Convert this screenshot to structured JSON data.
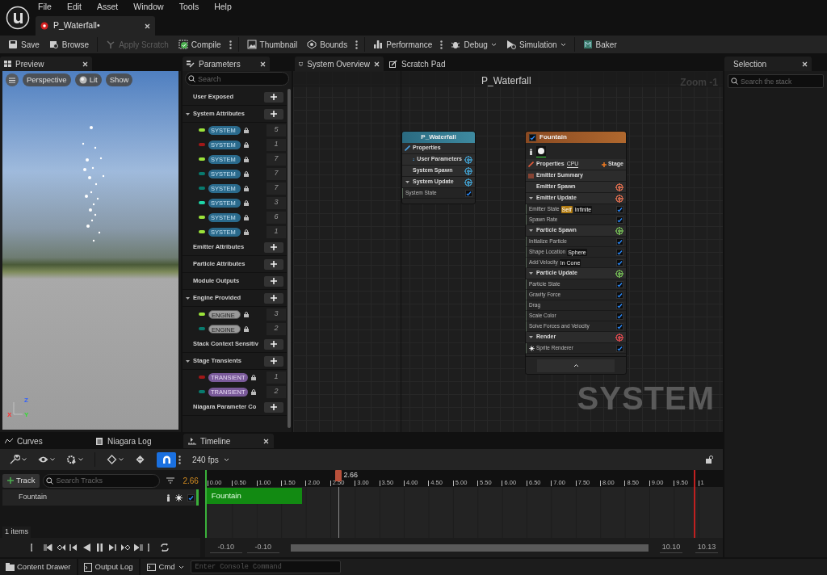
{
  "menu": [
    "File",
    "Edit",
    "Asset",
    "Window",
    "Tools",
    "Help"
  ],
  "document_tab": {
    "title": "P_Waterfall•"
  },
  "toolbar": [
    {
      "label": "Save",
      "kind": "button",
      "disabled": false
    },
    {
      "label": "Browse",
      "kind": "button",
      "disabled": false
    },
    {
      "label": "Apply Scratch",
      "kind": "button",
      "disabled": true
    },
    {
      "label": "Compile",
      "kind": "options",
      "disabled": false
    },
    {
      "label": "Thumbnail",
      "kind": "button",
      "disabled": false
    },
    {
      "label": "Bounds",
      "kind": "options",
      "disabled": false
    },
    {
      "label": "Performance",
      "kind": "options",
      "disabled": false
    },
    {
      "label": "Debug",
      "kind": "dropdown",
      "disabled": false
    },
    {
      "label": "Simulation",
      "kind": "dropdown",
      "disabled": false
    },
    {
      "label": "Baker",
      "kind": "button",
      "disabled": false
    }
  ],
  "preview": {
    "tab": "Preview",
    "buttons": [
      "Perspective",
      "Lit",
      "Show"
    ],
    "axes": [
      "Z",
      "X",
      "Y"
    ]
  },
  "parameters": {
    "tab": "Parameters",
    "search_placeholder": "Search",
    "sections": [
      {
        "title": "User Exposed"
      },
      {
        "title": "System Attributes",
        "expanded": true,
        "items": [
          {
            "kind": "system",
            "tag": "SYSTEM",
            "color": "#9be33a",
            "count": "5"
          },
          {
            "kind": "system",
            "tag": "SYSTEM",
            "color": "#a01818",
            "count": "1"
          },
          {
            "kind": "system",
            "tag": "SYSTEM",
            "color": "#9be33a",
            "count": "7"
          },
          {
            "kind": "system",
            "tag": "SYSTEM",
            "color": "#087a6e",
            "count": "7"
          },
          {
            "kind": "system",
            "tag": "SYSTEM",
            "color": "#087a6e",
            "count": "7"
          },
          {
            "kind": "system",
            "tag": "SYSTEM",
            "color": "#1ed6a8",
            "count": "3"
          },
          {
            "kind": "system",
            "tag": "SYSTEM",
            "color": "#9be33a",
            "count": "6"
          },
          {
            "kind": "system",
            "tag": "SYSTEM",
            "color": "#9be33a",
            "count": "1"
          }
        ]
      },
      {
        "title": "Emitter Attributes"
      },
      {
        "title": "Particle Attributes"
      },
      {
        "title": "Module Outputs"
      },
      {
        "title": "Engine Provided",
        "expanded": true,
        "items": [
          {
            "kind": "engine",
            "tag": "ENGINE",
            "color": "#9be33a",
            "count": "3"
          },
          {
            "kind": "engine",
            "tag": "ENGINE",
            "color": "#087a6e",
            "count": "2"
          }
        ]
      },
      {
        "title": "Stack Context Sensitiv"
      },
      {
        "title": "Stage Transients",
        "expanded": true,
        "items": [
          {
            "kind": "transient",
            "tag": "TRANSIENT",
            "color": "#a01818",
            "count": "1"
          },
          {
            "kind": "transient",
            "tag": "TRANSIENT",
            "color": "#087a6e",
            "count": "2"
          }
        ]
      },
      {
        "title": "Niagara Parameter Co"
      }
    ]
  },
  "graph": {
    "tabs": [
      {
        "label": "System Overview",
        "selected": true
      },
      {
        "label": "Scratch Pad",
        "selected": false
      }
    ],
    "title": "P_Waterfall",
    "zoom": "Zoom -1",
    "watermark": "SYSTEM",
    "nodes": [
      {
        "kind": "system",
        "title": "P_Waterfall",
        "rows": [
          {
            "kind": "link",
            "label": "Properties"
          },
          {
            "kind": "user_group",
            "label": "User Parameters",
            "color": "#3d8fb8"
          },
          {
            "kind": "group",
            "label": "System Spawn",
            "color": "#3d8fb8"
          },
          {
            "kind": "group",
            "label": "System Update",
            "expanded": true,
            "color": "#3d8fb8"
          },
          {
            "kind": "module",
            "label": "System State",
            "enabled": true
          }
        ]
      },
      {
        "kind": "emitter",
        "title": "Fountain",
        "enabled": true,
        "rows": [
          {
            "kind": "icons"
          },
          {
            "kind": "properties",
            "label": "Properties",
            "badge": "CPU",
            "action": "Stage"
          },
          {
            "kind": "summary",
            "label": "Emitter Summary"
          },
          {
            "kind": "group",
            "label": "Emitter Spawn",
            "color": "#c8654a"
          },
          {
            "kind": "group",
            "label": "Emitter Update",
            "expanded": true,
            "color": "#c8654a"
          },
          {
            "kind": "module",
            "label": "Emitter State",
            "tags": [
              {
                "text": "Self",
                "kind": "warn"
              },
              {
                "text": "Infinite",
                "kind": "plain"
              }
            ],
            "enabled": true
          },
          {
            "kind": "module",
            "label": "Spawn Rate",
            "enabled": true
          },
          {
            "kind": "group",
            "label": "Particle Spawn",
            "expanded": true,
            "color": "#6aa84f"
          },
          {
            "kind": "module",
            "label": "Initialize Particle",
            "enabled": true
          },
          {
            "kind": "module",
            "label": "Shape Location",
            "tags": [
              {
                "text": "Sphere",
                "kind": "plain"
              }
            ],
            "enabled": true
          },
          {
            "kind": "module",
            "label": "Add Velocity",
            "tags": [
              {
                "text": "In Cone",
                "kind": "plain"
              }
            ],
            "enabled": true
          },
          {
            "kind": "group",
            "label": "Particle Update",
            "expanded": true,
            "color": "#6aa84f"
          },
          {
            "kind": "module",
            "label": "Particle State",
            "enabled": true
          },
          {
            "kind": "module",
            "label": "Gravity Force",
            "enabled": true
          },
          {
            "kind": "module",
            "label": "Drag",
            "enabled": true
          },
          {
            "kind": "module",
            "label": "Scale Color",
            "enabled": true
          },
          {
            "kind": "module",
            "label": "Solve Forces and Velocity",
            "enabled": true
          },
          {
            "kind": "group",
            "label": "Render",
            "expanded": true,
            "color": "#c8454a"
          },
          {
            "kind": "renderer",
            "label": "Sprite Renderer",
            "enabled": true
          },
          {
            "kind": "collapse"
          }
        ]
      }
    ]
  },
  "selection": {
    "tab": "Selection",
    "search_placeholder": "Search the stack"
  },
  "bottom_tabs": [
    {
      "label": "Curves",
      "selected": false
    },
    {
      "label": "Niagara Log",
      "selected": false
    },
    {
      "label": "Timeline",
      "selected": true
    }
  ],
  "timeline": {
    "fps": "240 fps",
    "snap_on": true,
    "add_track": "Track",
    "search_placeholder": "Search Tracks",
    "current_time": "2.66",
    "tracks": [
      {
        "name": "Fountain",
        "enabled": true
      }
    ],
    "item_count": "1 items",
    "ticks": [
      "0.00",
      "0.50",
      "1.00",
      "1.50",
      "2.00",
      "2.50",
      "3.00",
      "3.50",
      "4.00",
      "4.50",
      "5.00",
      "5.50",
      "6.00",
      "6.50",
      "7.00",
      "7.50",
      "8.00",
      "8.50",
      "9.00",
      "9.50",
      "1"
    ],
    "clip": "Fountain",
    "playhead": "2.66",
    "view_start": "-0.10",
    "range_start": "-0.10",
    "range_end": "10.10",
    "view_end": "10.13"
  },
  "status_bar": {
    "items": [
      "Content Drawer",
      "Output Log"
    ],
    "cmd": "Cmd",
    "console_placeholder": "Enter Console Command"
  }
}
